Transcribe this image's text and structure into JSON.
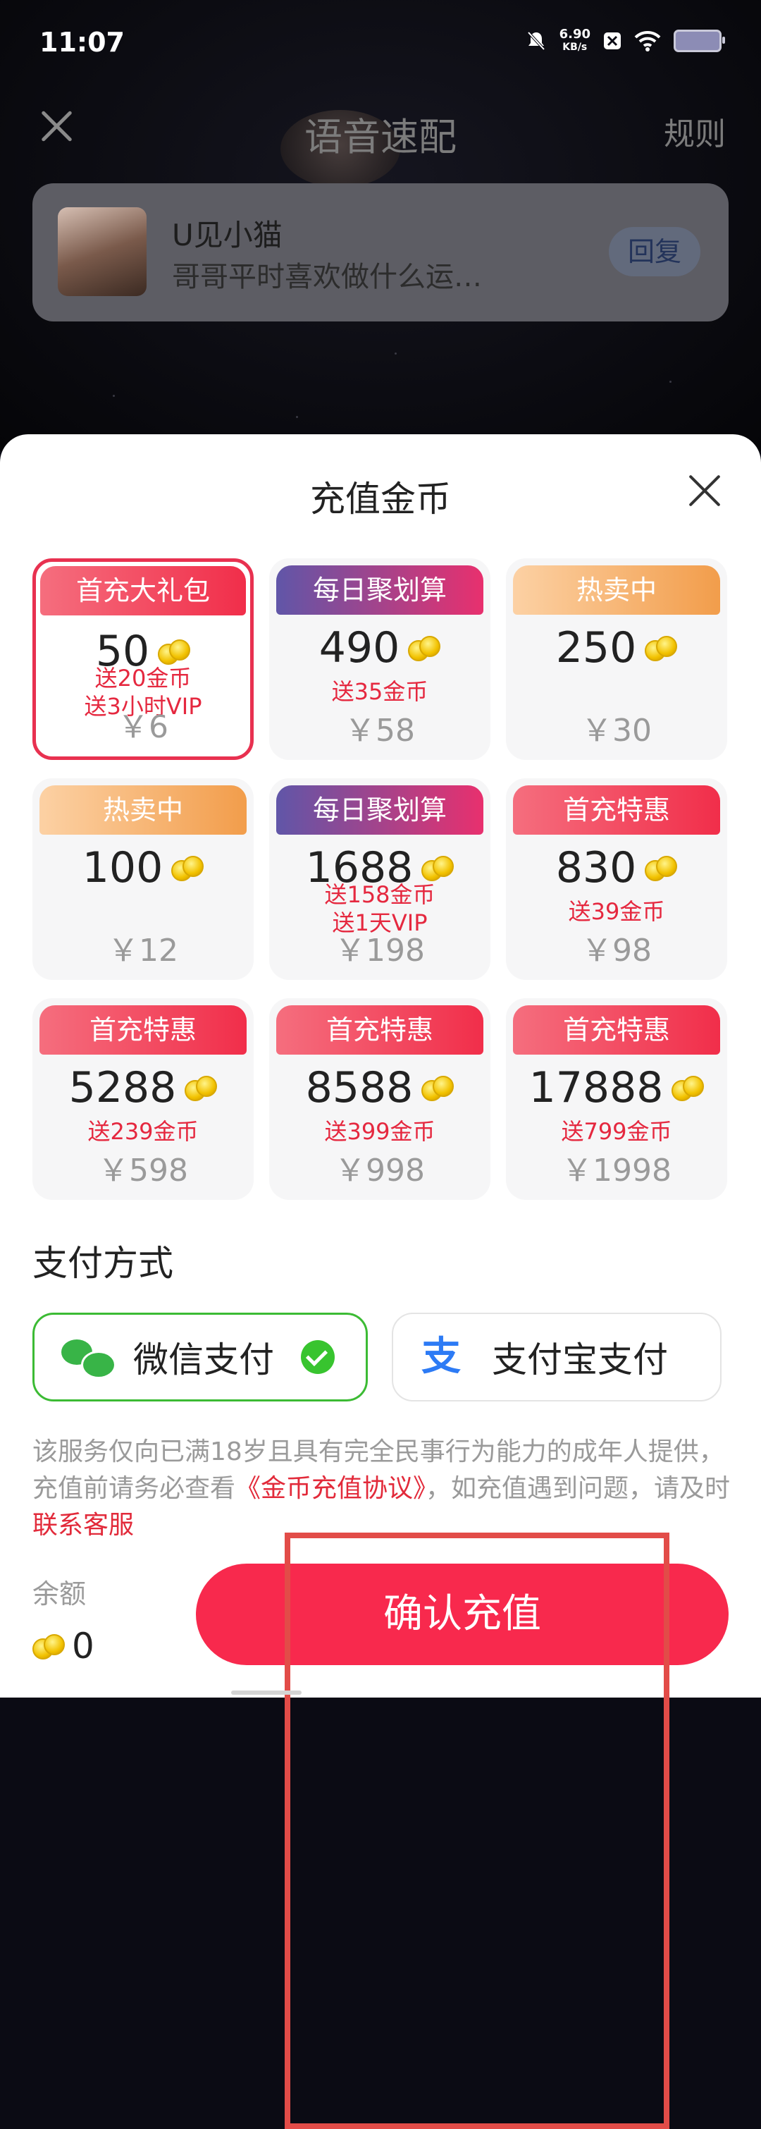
{
  "status_bar": {
    "time": "11:07",
    "net_speed_value": "6.90",
    "net_speed_unit": "KB/s"
  },
  "background_screen": {
    "title": "语音速配",
    "rules_label": "规则",
    "message": {
      "name": "U见小猫",
      "text": "哥哥平时喜欢做什么运…",
      "reply_label": "回复"
    }
  },
  "sheet": {
    "title": "充值金币",
    "packages": [
      {
        "tag": "首充大礼包",
        "tag_color": "red",
        "coins": "50",
        "bonus1": "送20金币",
        "bonus2": "送3小时VIP",
        "price": "￥6",
        "selected": true
      },
      {
        "tag": "每日聚划算",
        "tag_color": "purple",
        "coins": "490",
        "bonus1": "送35金币",
        "bonus2": "",
        "price": "￥58",
        "selected": false
      },
      {
        "tag": "热卖中",
        "tag_color": "orange",
        "coins": "250",
        "bonus1": "",
        "bonus2": "",
        "price": "￥30",
        "selected": false
      },
      {
        "tag": "热卖中",
        "tag_color": "orange",
        "coins": "100",
        "bonus1": "",
        "bonus2": "",
        "price": "￥12",
        "selected": false
      },
      {
        "tag": "每日聚划算",
        "tag_color": "purple",
        "coins": "1688",
        "bonus1": "送158金币",
        "bonus2": "送1天VIP",
        "price": "￥198",
        "selected": false
      },
      {
        "tag": "首充特惠",
        "tag_color": "red",
        "coins": "830",
        "bonus1": "送39金币",
        "bonus2": "",
        "price": "￥98",
        "selected": false
      },
      {
        "tag": "首充特惠",
        "tag_color": "red",
        "coins": "5288",
        "bonus1": "送239金币",
        "bonus2": "",
        "price": "￥598",
        "selected": false
      },
      {
        "tag": "首充特惠",
        "tag_color": "red",
        "coins": "8588",
        "bonus1": "送399金币",
        "bonus2": "",
        "price": "￥998",
        "selected": false
      },
      {
        "tag": "首充特惠",
        "tag_color": "red",
        "coins": "17888",
        "bonus1": "送799金币",
        "bonus2": "",
        "price": "￥1998",
        "selected": false
      }
    ],
    "payment": {
      "title": "支付方式",
      "wechat_label": "微信支付",
      "alipay_label": "支付宝支付",
      "selected": "wechat"
    },
    "notice": {
      "text1": "该服务仅向已满18岁且具有完全民事行为能力的成年人提供，充值前请务必查看",
      "agreement_link": "《金币充值协议》",
      "text2": "，如充值遇到问题，请及时",
      "support_link": "联系客服"
    },
    "balance": {
      "label": "余额",
      "value": "0"
    },
    "confirm_label": "确认充值"
  },
  "colors": {
    "accent": "#f8294d",
    "wechat_green": "#38b447",
    "alipay_blue": "#2d7bf5",
    "bonus_red": "#e5283f"
  }
}
